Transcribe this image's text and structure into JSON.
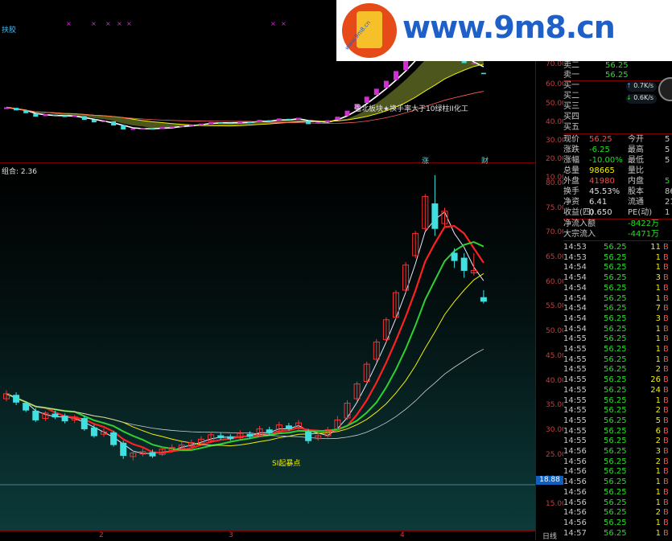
{
  "top_panel": {
    "indicator_label": "扶胶",
    "annotation": "强北板块★换手率大于10绿柱II化工",
    "y_ticks": [
      "70.00",
      "60.00",
      "50.00",
      "40.00",
      "30.00",
      "20.00",
      "10.00"
    ]
  },
  "main_panel": {
    "combo_label": "组合: 2.36",
    "bottom_label": "SI起暴点",
    "markers": [
      "涨",
      "财"
    ],
    "y_ticks": [
      "80.00",
      "75.00",
      "70.00",
      "65.00",
      "60.00",
      "55.00",
      "50.00",
      "45.00",
      "40.00",
      "35.00",
      "30.00",
      "25.00",
      "20.00",
      "15.00"
    ],
    "price_box": "18.88"
  },
  "time_axis": {
    "labels": [
      "2",
      "3",
      "4"
    ],
    "period": "日线"
  },
  "colors": {
    "up": "#ff3030",
    "down": "#40e0e0",
    "ma_yellow": "#f0f000",
    "ma_green": "#30d030",
    "ma_white": "#e0e0e0",
    "axis": "#7a0000"
  },
  "quote": {
    "ask_rows": [
      {
        "label": "卖二",
        "value": "",
        "qty": ""
      },
      {
        "label": "卖一",
        "value": "56.25",
        "qty": ""
      }
    ],
    "sell1_top": "56.25",
    "sell1_qty": "",
    "bid_rows": [
      {
        "label": "买一"
      },
      {
        "label": "买二"
      },
      {
        "label": "买三"
      },
      {
        "label": "买四"
      },
      {
        "label": "买五"
      }
    ],
    "speed1": "0.7K/s",
    "speed2": "0.6K/s",
    "stats": [
      {
        "l1": "现价",
        "v1": "56.25",
        "l2": "今开",
        "v2": "5"
      },
      {
        "l1": "涨跌",
        "v1": "-6.25",
        "l2": "最高",
        "v2": "5"
      },
      {
        "l1": "涨幅",
        "v1": "-10.00%",
        "l2": "最低",
        "v2": "5"
      },
      {
        "l1": "总量",
        "v1": "98665",
        "l2": "量比",
        "v2": ""
      },
      {
        "l1": "外盘",
        "v1": "41980",
        "l2": "内盘",
        "v2": "5"
      },
      {
        "l1": "换手",
        "v1": "45.53%",
        "l2": "股本",
        "v2": "86"
      },
      {
        "l1": "净资",
        "v1": "6.41",
        "l2": "流通",
        "v2": "21"
      },
      {
        "l1": "收益(四)",
        "v1": "0.650",
        "l2": "PE(动)",
        "v2": "1"
      }
    ],
    "net_inflow_label": "净流入额",
    "net_inflow_value": "-8422万",
    "bigdeal_label": "大宗流入",
    "bigdeal_value": "-4471万",
    "trades": [
      {
        "t": "14:53",
        "p": "56.25",
        "q": "11",
        "f": "B"
      },
      {
        "t": "14:53",
        "p": "56.25",
        "q": "1",
        "f": "B"
      },
      {
        "t": "14:54",
        "p": "56.25",
        "q": "1",
        "f": "B"
      },
      {
        "t": "14:54",
        "p": "56.25",
        "q": "3",
        "f": "B"
      },
      {
        "t": "14:54",
        "p": "56.25",
        "q": "1",
        "f": "B"
      },
      {
        "t": "14:54",
        "p": "56.25",
        "q": "1",
        "f": "B"
      },
      {
        "t": "14:54",
        "p": "56.25",
        "q": "7",
        "f": "B"
      },
      {
        "t": "14:54",
        "p": "56.25",
        "q": "3",
        "f": "B"
      },
      {
        "t": "14:54",
        "p": "56.25",
        "q": "1",
        "f": "B"
      },
      {
        "t": "14:55",
        "p": "56.25",
        "q": "1",
        "f": "B"
      },
      {
        "t": "14:55",
        "p": "56.25",
        "q": "1",
        "f": "B"
      },
      {
        "t": "14:55",
        "p": "56.25",
        "q": "1",
        "f": "B"
      },
      {
        "t": "14:55",
        "p": "56.25",
        "q": "2",
        "f": "B"
      },
      {
        "t": "14:55",
        "p": "56.25",
        "q": "26",
        "f": "B"
      },
      {
        "t": "14:55",
        "p": "56.25",
        "q": "24",
        "f": "B"
      },
      {
        "t": "14:55",
        "p": "56.25",
        "q": "1",
        "f": "B"
      },
      {
        "t": "14:55",
        "p": "56.25",
        "q": "2",
        "f": "B"
      },
      {
        "t": "14:55",
        "p": "56.25",
        "q": "5",
        "f": "B"
      },
      {
        "t": "14:55",
        "p": "56.25",
        "q": "6",
        "f": "B"
      },
      {
        "t": "14:55",
        "p": "56.25",
        "q": "2",
        "f": "B"
      },
      {
        "t": "14:56",
        "p": "56.25",
        "q": "3",
        "f": "B"
      },
      {
        "t": "14:56",
        "p": "56.25",
        "q": "2",
        "f": "B"
      },
      {
        "t": "14:56",
        "p": "56.25",
        "q": "1",
        "f": "B"
      },
      {
        "t": "14:56",
        "p": "56.25",
        "q": "1",
        "f": "B"
      },
      {
        "t": "14:56",
        "p": "56.25",
        "q": "1",
        "f": "B"
      },
      {
        "t": "14:56",
        "p": "56.25",
        "q": "1",
        "f": "B"
      },
      {
        "t": "14:56",
        "p": "56.25",
        "q": "2",
        "f": "B"
      },
      {
        "t": "14:56",
        "p": "56.25",
        "q": "1",
        "f": "B"
      },
      {
        "t": "14:57",
        "p": "56.25",
        "q": "1",
        "f": "B"
      }
    ]
  },
  "watermark": {
    "site": "www.9m8.cn",
    "sub": "www.9m8.cn"
  },
  "candles": [
    {
      "o": 36.5,
      "c": 37.5,
      "h": 38.2,
      "l": 36.0
    },
    {
      "o": 37.2,
      "c": 35.8,
      "h": 37.8,
      "l": 35.2
    },
    {
      "o": 35.6,
      "c": 34.2,
      "h": 36.0,
      "l": 33.8
    },
    {
      "o": 34.0,
      "c": 32.2,
      "h": 34.6,
      "l": 31.8
    },
    {
      "o": 32.5,
      "c": 33.6,
      "h": 34.0,
      "l": 32.0
    },
    {
      "o": 33.4,
      "c": 32.8,
      "h": 34.1,
      "l": 32.4
    },
    {
      "o": 33.0,
      "c": 32.0,
      "h": 33.5,
      "l": 31.5
    },
    {
      "o": 32.2,
      "c": 32.8,
      "h": 33.2,
      "l": 31.6
    },
    {
      "o": 32.5,
      "c": 30.4,
      "h": 33.1,
      "l": 30.0
    },
    {
      "o": 30.6,
      "c": 29.0,
      "h": 31.2,
      "l": 28.6
    },
    {
      "o": 29.3,
      "c": 29.8,
      "h": 30.5,
      "l": 28.8
    },
    {
      "o": 29.6,
      "c": 27.2,
      "h": 30.0,
      "l": 26.8
    },
    {
      "o": 27.5,
      "c": 25.0,
      "h": 28.0,
      "l": 24.3
    },
    {
      "o": 24.8,
      "c": 25.5,
      "h": 26.0,
      "l": 24.0
    },
    {
      "o": 25.3,
      "c": 25.8,
      "h": 26.4,
      "l": 24.8
    },
    {
      "o": 25.6,
      "c": 24.9,
      "h": 26.2,
      "l": 24.5
    },
    {
      "o": 25.2,
      "c": 26.3,
      "h": 26.8,
      "l": 24.9
    },
    {
      "o": 26.0,
      "c": 26.6,
      "h": 27.3,
      "l": 25.6
    },
    {
      "o": 26.4,
      "c": 27.1,
      "h": 27.8,
      "l": 26.0
    },
    {
      "o": 26.9,
      "c": 27.6,
      "h": 28.2,
      "l": 26.5
    },
    {
      "o": 27.4,
      "c": 28.3,
      "h": 28.9,
      "l": 27.0
    },
    {
      "o": 28.0,
      "c": 29.2,
      "h": 29.8,
      "l": 27.8
    },
    {
      "o": 29.0,
      "c": 28.6,
      "h": 29.6,
      "l": 28.2
    },
    {
      "o": 28.8,
      "c": 28.4,
      "h": 29.3,
      "l": 28.0
    },
    {
      "o": 28.6,
      "c": 29.5,
      "h": 30.1,
      "l": 28.3
    },
    {
      "o": 29.3,
      "c": 28.9,
      "h": 29.9,
      "l": 28.5
    },
    {
      "o": 29.0,
      "c": 30.4,
      "h": 31.0,
      "l": 28.8
    },
    {
      "o": 30.2,
      "c": 29.6,
      "h": 30.8,
      "l": 29.2
    },
    {
      "o": 29.8,
      "c": 31.2,
      "h": 31.8,
      "l": 29.5
    },
    {
      "o": 31.0,
      "c": 30.4,
      "h": 31.6,
      "l": 30.0
    },
    {
      "o": 30.6,
      "c": 31.6,
      "h": 32.2,
      "l": 30.2
    },
    {
      "o": 29.8,
      "c": 28.0,
      "h": 30.4,
      "l": 27.4
    },
    {
      "o": 28.4,
      "c": 29.0,
      "h": 29.6,
      "l": 28.0
    },
    {
      "o": 29.0,
      "c": 30.2,
      "h": 30.8,
      "l": 28.6
    },
    {
      "o": 30.4,
      "c": 32.2,
      "h": 33.0,
      "l": 30.0
    },
    {
      "o": 32.6,
      "c": 35.6,
      "h": 36.2,
      "l": 32.2
    },
    {
      "o": 36.5,
      "c": 39.5,
      "h": 40.0,
      "l": 36.0
    },
    {
      "o": 40.0,
      "c": 43.5,
      "h": 44.0,
      "l": 39.5
    },
    {
      "o": 44.5,
      "c": 48.0,
      "h": 48.6,
      "l": 44.0
    },
    {
      "o": 48.5,
      "c": 52.5,
      "h": 53.0,
      "l": 48.0
    },
    {
      "o": 53.0,
      "c": 58.0,
      "h": 58.5,
      "l": 52.5
    },
    {
      "o": 58.5,
      "c": 63.6,
      "h": 64.2,
      "l": 58.0
    },
    {
      "o": 65.5,
      "c": 70.0,
      "h": 70.5,
      "l": 65.0
    },
    {
      "o": 71.0,
      "c": 77.5,
      "h": 78.0,
      "l": 70.5
    },
    {
      "o": 76.0,
      "c": 71.0,
      "h": 81.8,
      "l": 69.5
    },
    {
      "o": 72.0,
      "c": 74.5,
      "h": 75.2,
      "l": 71.5
    },
    {
      "o": 66.0,
      "c": 64.5,
      "h": 67.0,
      "l": 63.0
    },
    {
      "o": 65.0,
      "c": 62.5,
      "h": 66.0,
      "l": 61.0
    },
    {
      "o": 62.0,
      "c": 62.5,
      "h": 66.0,
      "l": 61.5
    },
    {
      "o": 57.0,
      "c": 56.25,
      "h": 58.5,
      "l": 55.8
    }
  ]
}
